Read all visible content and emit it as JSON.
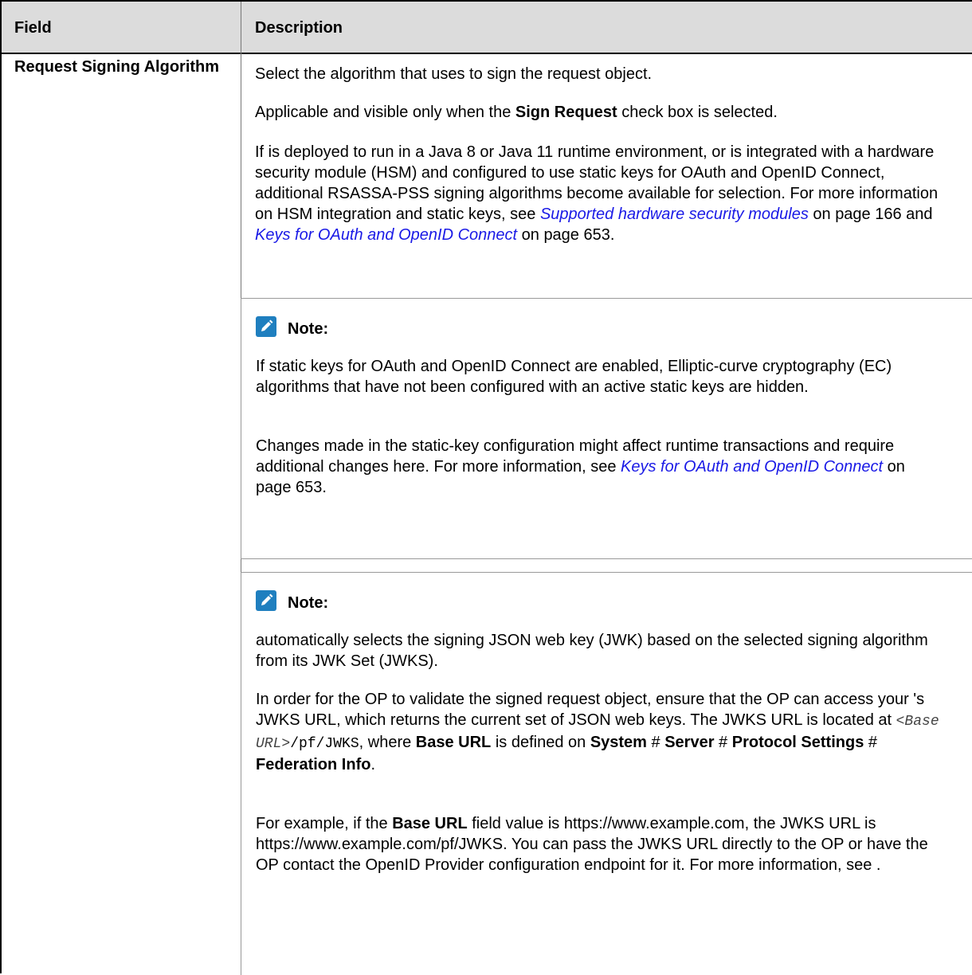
{
  "table": {
    "headers": {
      "field": "Field",
      "description": "Description"
    },
    "row": {
      "field": "Request Signing Algorithm",
      "p1": "Select the algorithm that  uses to sign the request object.",
      "p2": {
        "pre": "Applicable and visible only when the ",
        "bold": "Sign Request",
        "post": " check box is selected."
      },
      "p3": {
        "text": "If  is deployed to run in a Java 8 or Java 11 runtime environment, or is integrated with a hardware security module (HSM) and configured to use static keys for OAuth and OpenID Connect, additional RSASSA-PSS signing algorithms become available for selection. For more information on HSM integration and static keys, see ",
        "link1": "Supported hardware security modules",
        "mid": " on page 166 and ",
        "link2": "Keys for OAuth and OpenID Connect",
        "end": " on page 653."
      },
      "note1": {
        "title": "Note:",
        "icon": "edit-pencil-icon",
        "p1": "If static keys for OAuth and OpenID Connect are enabled, Elliptic-curve cryptography (EC) algorithms that have not been configured with an active static keys are hidden.",
        "p2": {
          "text": "Changes made in the static-key configuration might affect runtime transactions and require additional changes here. For more information, see ",
          "link": "Keys for OAuth and OpenID Connect",
          "end": " on page 653."
        }
      },
      "note2": {
        "title": "Note:",
        "icon": "edit-pencil-icon",
        "p1": "automatically selects the signing JSON web key (JWK) based on the selected signing algorithm from its JWK Set (JWKS).",
        "p2": {
          "text": "In order for the OP to validate the signed request object, ensure that the OP can access your 's JWKS URL, which returns the current set of JSON web keys. The  JWKS URL is located at ",
          "code_italic": "<Base URL>",
          "code": "/pf/JWKS",
          "comma_where": ", where ",
          "bold1": "Base URL",
          "is_defined": " is defined on ",
          "bold2": "System",
          "sep1": " # ",
          "bold3": "Server",
          "sep2": " # ",
          "bold4": "Protocol Settings",
          "sep3": " # ",
          "bold5": "Federation Info",
          "end": "."
        },
        "p3": {
          "pre": "For example, if the ",
          "bold": "Base URL",
          "post": " field value is https://www.example.com, the  JWKS URL is https://www.example.com/pf/JWKS. You can pass the JWKS URL directly to the OP or have the OP contact the  OpenID Provider configuration endpoint for it. For more information, see ."
        }
      }
    }
  },
  "colors": {
    "header_bg": "#dcdcdc",
    "link": "#1a1ae6",
    "note_icon": "#1f7fbf"
  }
}
